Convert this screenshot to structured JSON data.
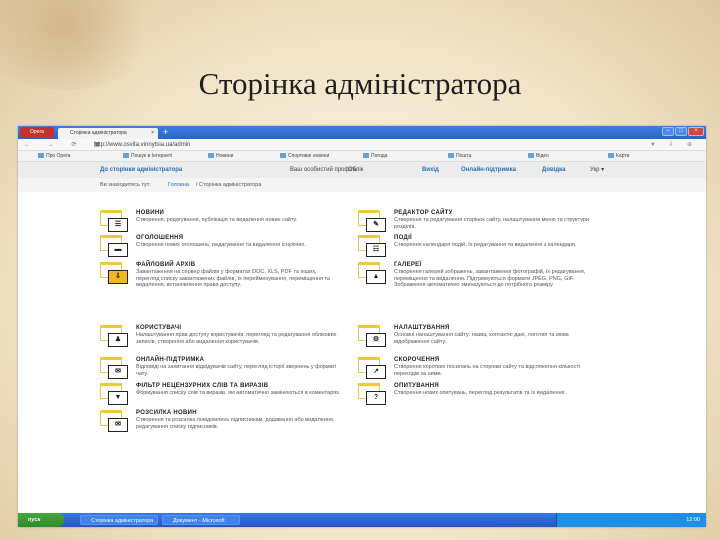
{
  "slide_title": "Сторінка адміністратора",
  "browser": {
    "opera_label": "Opera",
    "tab_title": "Сторінка адміністратора",
    "tab_close": "×",
    "new_tab": "+",
    "url": "http://www.osvita.vinnytsia.ua/admin",
    "nav_icons": "← → ⟳ ▦",
    "right_icons": "♥ ⇩ ⊕",
    "bookmarks": [
      "Про Opera",
      "Пошук в Інтернеті",
      "Новини",
      "Спортивні новини",
      "Погода",
      "Пошта",
      "Відео",
      "Карти"
    ],
    "win_buttons": [
      "–",
      "□",
      "×"
    ]
  },
  "site": {
    "home_link": "До сторінки адміністратора",
    "user": "Ваш особистий профіль",
    "user_sub": "Облік",
    "nav": [
      "Вихід",
      "Онлайн-підтримка",
      "Довідка",
      "Укр ▾"
    ],
    "breadcrumb_prefix": "Ви знаходитесь тут:",
    "breadcrumb_link": "Головна",
    "breadcrumb_current": "/ Сторінка адміністратора"
  },
  "left_items": [
    {
      "title": "НОВИНИ",
      "desc": "Створення, редагування, публікація та видалення новин сайту.",
      "icon": "news-icon",
      "glyph": "☰"
    },
    {
      "title": "ОГОЛОШЕННЯ",
      "desc": "Створення нових оголошень, редагування та видалення існуючих.",
      "icon": "announcement-icon",
      "glyph": "▬"
    },
    {
      "title": "ФАЙЛОВИЙ АРХІВ",
      "desc": "Завантаження на сервер файлів у форматах DOC, XLS, PDF та інших, перегляд списку завантажених файлів, їх перейменування, переміщення та видалення, встановлення права доступу.",
      "icon": "file-archive-icon",
      "glyph": "⇩"
    },
    {
      "title": "КОРИСТУВАЧІ",
      "desc": "Налаштування прав доступу користувачів, перегляд та редагування облікових записів, створення або видалення користувачів.",
      "icon": "users-icon",
      "glyph": "♟"
    },
    {
      "title": "ОНЛАЙН-ПІДТРИМКА",
      "desc": "Відповіді на запитання відвідувачів сайту, перегляд історії звернень у форматі чату.",
      "icon": "support-icon",
      "glyph": "✉"
    },
    {
      "title": "ФІЛЬТР НЕЦЕНЗУРНИХ СЛІВ ТА ВИРАЗІВ",
      "desc": "Формування списку слів та виразів, які автоматично замінюються в коментарях.",
      "icon": "filter-icon",
      "glyph": "▼"
    },
    {
      "title": "РОЗСИЛКА НОВИН",
      "desc": "Створення та розсилка повідомлень підписникам, додавання або видалення, редагування списку підписників.",
      "icon": "mailing-icon",
      "glyph": "✉"
    }
  ],
  "right_items": [
    {
      "title": "РЕДАКТОР САЙТУ",
      "desc": "Створення та редагування сторінок сайту, налаштування меню та структури розділів.",
      "icon": "site-editor-icon",
      "glyph": "✎"
    },
    {
      "title": "ПОДІЇ",
      "desc": "Створення календаря подій, їх редагування та видалення з календаря.",
      "icon": "events-icon",
      "glyph": "☷"
    },
    {
      "title": "ГАЛЕРЕЇ",
      "desc": "Створення галерей зображень, завантаження фотографій, їх редагування, переміщення та видалення. Підтримуються формати JPEG, PNG, GIF. Зображення автоматично зменшуються до потрібного розміру.",
      "icon": "gallery-icon",
      "glyph": "▲"
    },
    {
      "title": "НАЛАШТУВАННЯ",
      "desc": "Основні налаштування сайту: назва, контактні дані, логотип та мова відображення сайту.",
      "icon": "settings-icon",
      "glyph": "⚙"
    },
    {
      "title": "СКОРОЧЕННЯ",
      "desc": "Створення коротких посилань на сторінки сайту та відстеження кількості переходів за ними.",
      "icon": "shortlink-icon",
      "glyph": "↗"
    },
    {
      "title": "ОПИТУВАННЯ",
      "desc": "Створення нових опитувань, перегляд результатів та їх видалення.",
      "icon": "poll-icon",
      "glyph": "?"
    }
  ],
  "taskbar": {
    "start": "пуск",
    "tasks": [
      "Сторінка адміністратора",
      "Документ - Microsoft Word"
    ],
    "clock": "12:00"
  }
}
